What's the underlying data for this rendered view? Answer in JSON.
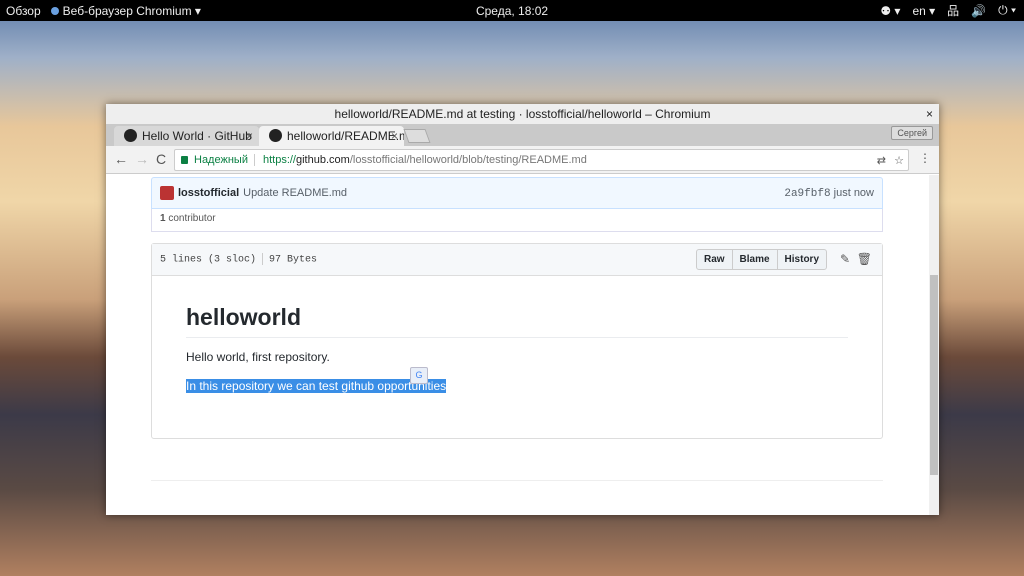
{
  "topbar": {
    "activities": "Обзор",
    "app": "Веб-браузер Chromium ▾",
    "clock": "Среда, 18:02",
    "accessibility": "⚉ ▾",
    "lang": "en ▾",
    "network": "品",
    "volume": "🔊",
    "power": "⏻ ▾"
  },
  "window": {
    "title": "helloworld/README.md at testing · losstofficial/helloworld – Chromium",
    "close": "×"
  },
  "tabs": [
    {
      "label": "Hello World · GitHub",
      "close": "×"
    },
    {
      "label": "helloworld/README.md",
      "close": "×"
    }
  ],
  "profile": "Сергей",
  "toolbar": {
    "back": "←",
    "forward": "→",
    "reload": "C",
    "secure": "Надежный",
    "url_scheme": "https://",
    "url_host": "github.com",
    "url_path": "/losstofficial/helloworld/blob/testing/README.md",
    "translate": "⇄",
    "star": "☆",
    "menu": "⋮"
  },
  "commit": {
    "author": "losstofficial",
    "message": "Update README.md",
    "sha": "2a9fbf8",
    "time": "just now"
  },
  "contributors": {
    "count": "1",
    "label": "contributor"
  },
  "file": {
    "lines": "5 lines (3 sloc)",
    "size": "97 Bytes",
    "buttons": [
      "Raw",
      "Blame",
      "History"
    ],
    "edit": "✎",
    "delete": "🗑"
  },
  "readme": {
    "heading": "helloworld",
    "p1": "Hello world, first repository.",
    "p2": "In this repository we can test github opportunities"
  },
  "translate_bubble": "G"
}
